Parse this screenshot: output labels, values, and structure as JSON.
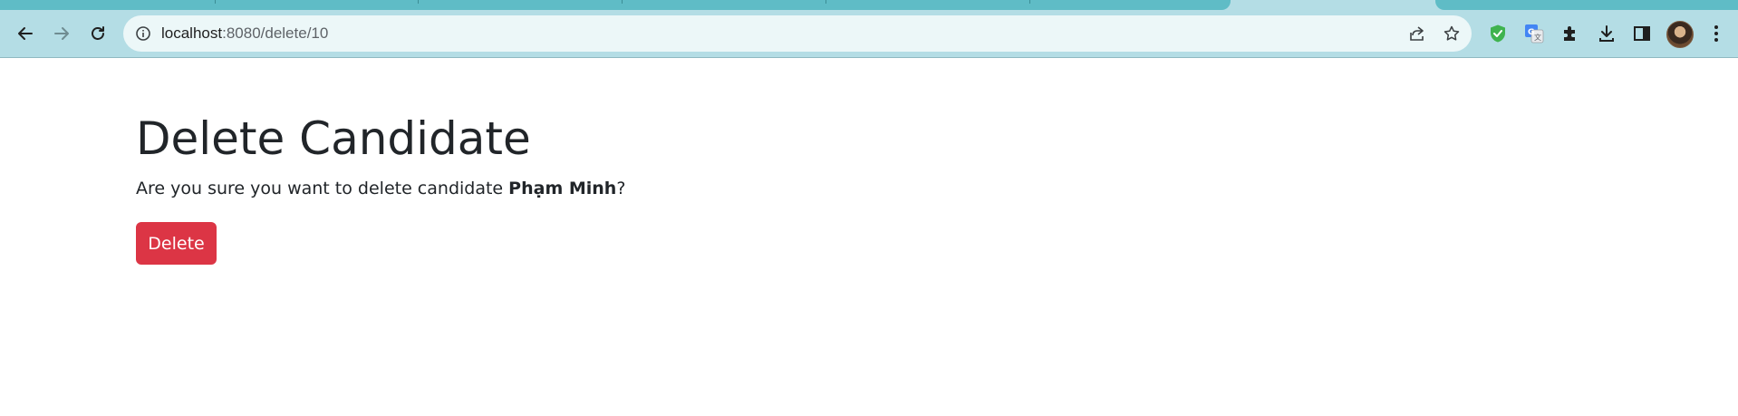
{
  "browser": {
    "url_host": "localhost",
    "url_path": ":8080/delete/10"
  },
  "page": {
    "title": "Delete Candidate",
    "confirm_prefix": "Are you sure you want to delete candidate ",
    "candidate_name": "Phạm Minh",
    "confirm_suffix": "?",
    "delete_label": "Delete"
  },
  "colors": {
    "danger": "#dc3545",
    "text": "#212529",
    "chrome": "#b4dde5"
  }
}
